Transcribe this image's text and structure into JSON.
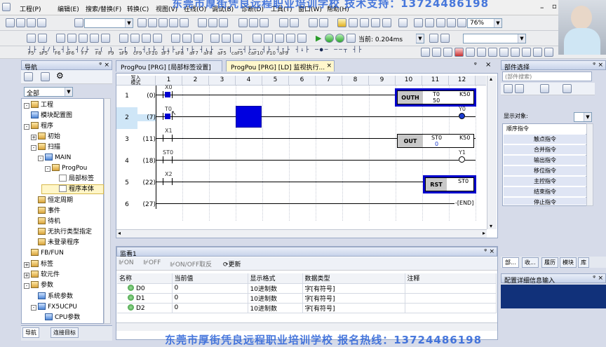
{
  "watermark_top": "东莞市厚街凭良远程职业培训学校  技术支持：13724486198",
  "watermark_bottom": "东莞市厚街凭良远程职业培训学校  报名热线：13724486198",
  "menu": [
    "工程(P)",
    "编辑(E)",
    "搜索/替换(F)",
    "转换(C)",
    "视图(V)",
    "在线(O)",
    "调试(B)",
    "诊断(D)",
    "工具(T)",
    "窗口(W)",
    "帮助(H)"
  ],
  "toolbar": {
    "scan_time": "当前: 0.204ms",
    "zoom": "76%"
  },
  "fkeys": [
    "F5",
    "sF5",
    "F6",
    "sF6",
    "F7",
    "F8",
    "F9",
    "sF9",
    "cF9",
    "cF10",
    "sF7",
    "sF8",
    "aF7",
    "aF8",
    "aF5",
    "caF5",
    "caF10",
    "F10",
    "aF9"
  ],
  "nav": {
    "title": "导航",
    "filter": "全部",
    "tree": [
      {
        "label": "工程",
        "level": 0,
        "exp": "-"
      },
      {
        "label": "模块配置图",
        "level": 1
      },
      {
        "label": "程序",
        "level": 1,
        "exp": "-"
      },
      {
        "label": "初始",
        "level": 2,
        "exp": "+"
      },
      {
        "label": "扫描",
        "level": 2,
        "exp": "-"
      },
      {
        "label": "MAIN",
        "level": 3,
        "exp": "-"
      },
      {
        "label": "ProgPou",
        "level": 4,
        "exp": "-"
      },
      {
        "label": "局部标签",
        "level": 5
      },
      {
        "label": "程序本体",
        "level": 5
      },
      {
        "label": "恒定周期",
        "level": 2
      },
      {
        "label": "事件",
        "level": 2
      },
      {
        "label": "待机",
        "level": 2
      },
      {
        "label": "无执行类型指定",
        "level": 2
      },
      {
        "label": "未登录程序",
        "level": 2
      },
      {
        "label": "FB/FUN",
        "level": 1
      },
      {
        "label": "标签",
        "level": 0,
        "exp": "+"
      },
      {
        "label": "软元件",
        "level": 0,
        "exp": "+"
      },
      {
        "label": "参数",
        "level": 0,
        "exp": "-"
      },
      {
        "label": "系统参数",
        "level": 1
      },
      {
        "label": "FX5UCPU",
        "level": 1,
        "exp": "-"
      },
      {
        "label": "CPU参数",
        "level": 2
      }
    ],
    "bottom_tabs": [
      "导航",
      "连接目标"
    ]
  },
  "editor": {
    "tabs": [
      "ProgPou [PRG] [局部标签设置]",
      "ProgPou [PRG] [LD] 监视执行..."
    ],
    "corner": "写入\n模式",
    "columns": [
      "1",
      "2",
      "3",
      "4",
      "5",
      "6",
      "7",
      "8",
      "9",
      "10",
      "11",
      "12"
    ],
    "rows": [
      {
        "num": "1",
        "step": "(0)"
      },
      {
        "num": "2",
        "step": "(7)"
      },
      {
        "num": "3",
        "step": "(11)"
      },
      {
        "num": "4",
        "step": "(18)"
      },
      {
        "num": "5",
        "step": "(22)"
      },
      {
        "num": "6",
        "step": "(27)"
      }
    ],
    "labels": {
      "x0": "X0",
      "t0": "T0",
      "x1": "X1",
      "st0": "ST0",
      "x2": "X2",
      "outh": "OUTH",
      "outh_t": "T0",
      "outh_v": "50",
      "k50a": "K50",
      "y0": "Y0",
      "out": "OUT",
      "out_st": "ST0",
      "out_v": "0",
      "k50b": "K50",
      "y1": "Y1",
      "rst": "RST",
      "rst_st": "ST0",
      "end": "END"
    }
  },
  "watch": {
    "title": "监看1",
    "buttons": [
      "ON",
      "OFF",
      "ON/OFF取反",
      "更新"
    ],
    "headers": [
      "名称",
      "当前值",
      "显示格式",
      "数据类型",
      "注释"
    ],
    "rows": [
      [
        "D0",
        "0",
        "10进制数",
        "字[有符号]",
        ""
      ],
      [
        "D1",
        "0",
        "10进制数",
        "字[有符号]",
        ""
      ],
      [
        "D2",
        "0",
        "10进制数",
        "字[有符号]",
        ""
      ]
    ]
  },
  "parts": {
    "title": "部件选择",
    "search": "(部件搜索)",
    "show_label": "显示对象:",
    "items": [
      "顺序指令",
      "触点指令",
      "合并指令",
      "输出指令",
      "移位指令",
      "主控指令",
      "结束指令",
      "停止指令"
    ],
    "tabs": [
      "部...",
      "收...",
      "履历",
      "模块",
      "库"
    ],
    "detail_title": "配置详细信息输入"
  }
}
